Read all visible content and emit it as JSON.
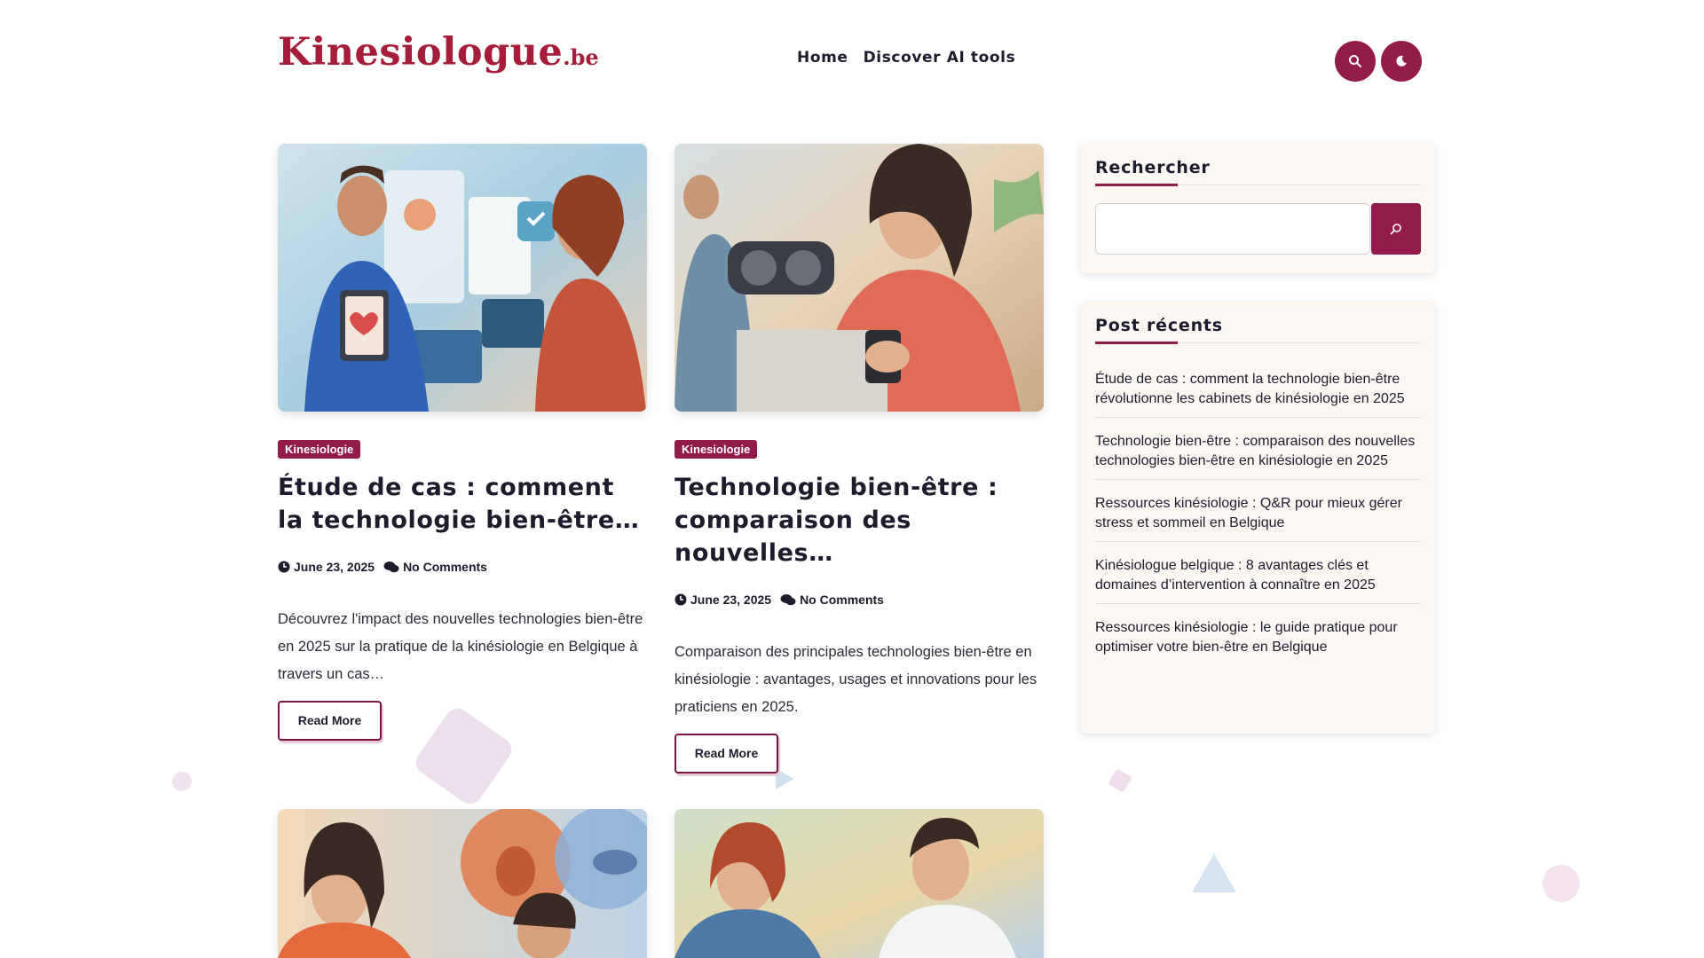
{
  "site": {
    "logo_main": "Kinesiologue",
    "logo_tld": ".be"
  },
  "nav": {
    "items": [
      "Home",
      "Discover AI tools"
    ]
  },
  "header": {
    "search_icon": "search-icon",
    "theme_icon": "moon-icon"
  },
  "posts": [
    {
      "category": "Kinesiologie",
      "title": "Étude de cas : comment la technologie bien-être…",
      "date": "June 23, 2025",
      "comments": "No Comments",
      "excerpt": "Découvrez l'impact des nouvelles technologies bien-être en 2025 sur la pratique de la kinésiologie en Belgique à travers un cas…",
      "read_more": "Read More"
    },
    {
      "category": "Kinesiologie",
      "title": "Technologie bien-être : comparaison des nouvelles…",
      "date": "June 23, 2025",
      "comments": "No Comments",
      "excerpt": "Comparaison des principales technologies bien-être en kinésiologie : avantages, usages et innovations pour les praticiens en 2025.",
      "read_more": "Read More"
    }
  ],
  "sidebar": {
    "search_title": "Rechercher",
    "search_value": "",
    "recent_title": "Post récents",
    "recent_posts": [
      "Étude de cas : comment la technologie bien-être révolutionne les cabinets de kinésiologie en 2025",
      "Technologie bien-être : comparaison des nouvelles technologies bien-être en kinésiologie en 2025",
      "Ressources kinésiologie : Q&R pour mieux gérer stress et sommeil en Belgique",
      "Kinésiologue belgique : 8 avantages clés et domaines d’intervention à connaître en 2025",
      "Ressources kinésiologie : le guide pratique pour optimiser votre bien-être en Belgique"
    ]
  },
  "colors": {
    "brand": "#a61d3a",
    "accent": "#931b4a"
  }
}
